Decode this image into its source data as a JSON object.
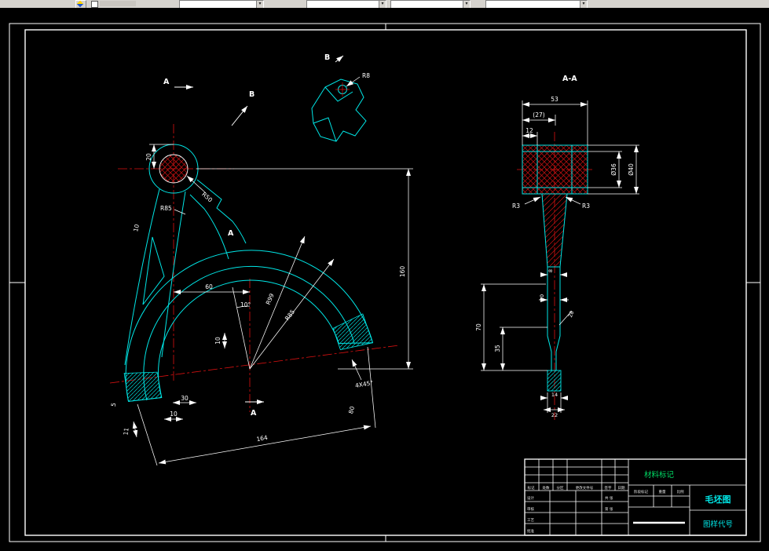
{
  "colors": {
    "outline": "#00e6e6",
    "centerline": "#dd1111",
    "dimension": "#ffffff",
    "hatch": "#cc1111",
    "toolbar_bg": "#d6d3ce",
    "material_label_color": "#00dd66"
  },
  "toolbar": {
    "icon": "app-icon"
  },
  "front_view": {
    "label_a_top": "A",
    "label_a_mid": "A",
    "label_a_bottom": "A",
    "label_b": "B",
    "dim_20": "20",
    "dim_r50": "R50",
    "dim_r85_arm": "R85",
    "dim_10_arm": "10",
    "dim_60": "60",
    "dim_angle": "10°",
    "dim_r99": "R99",
    "dim_r85": "R85",
    "dim_160": "160",
    "dim_10_mid": "10",
    "dim_30": "30",
    "dim_10_bottom": "10",
    "dim_11": "11",
    "dim_5": "5",
    "dim_164": "164",
    "dim_chamfer": "4X45°",
    "dim_80": "80"
  },
  "detail_view": {
    "title": "B",
    "dim_r8": "R8"
  },
  "section_view": {
    "title": "A-A",
    "dim_53": "53",
    "dim_27": "(27)",
    "dim_12": "12",
    "dim_d36": "Ø36",
    "dim_d40": "Ø40",
    "dim_r3_left": "R3",
    "dim_r3_right": "R3",
    "dim_8": "8",
    "dim_10": "10",
    "dim_28": "28",
    "dim_70": "70",
    "dim_35": "35",
    "dim_14": "14",
    "dim_22": "22"
  },
  "title_block": {
    "material_label": "材料标记",
    "drawing_type": "毛坯图",
    "code_label": "图样代号",
    "rev_headers": [
      "标记",
      "处数",
      "分区",
      "更改文件号",
      "签字",
      "日期"
    ],
    "sign_rows": [
      "设计",
      "审核",
      "工艺",
      "批准"
    ],
    "stage_label": "阶段标记",
    "weight_label": "重量",
    "scale_label": "比例",
    "sheet_total": "共 张",
    "sheet_no": "第 张"
  }
}
